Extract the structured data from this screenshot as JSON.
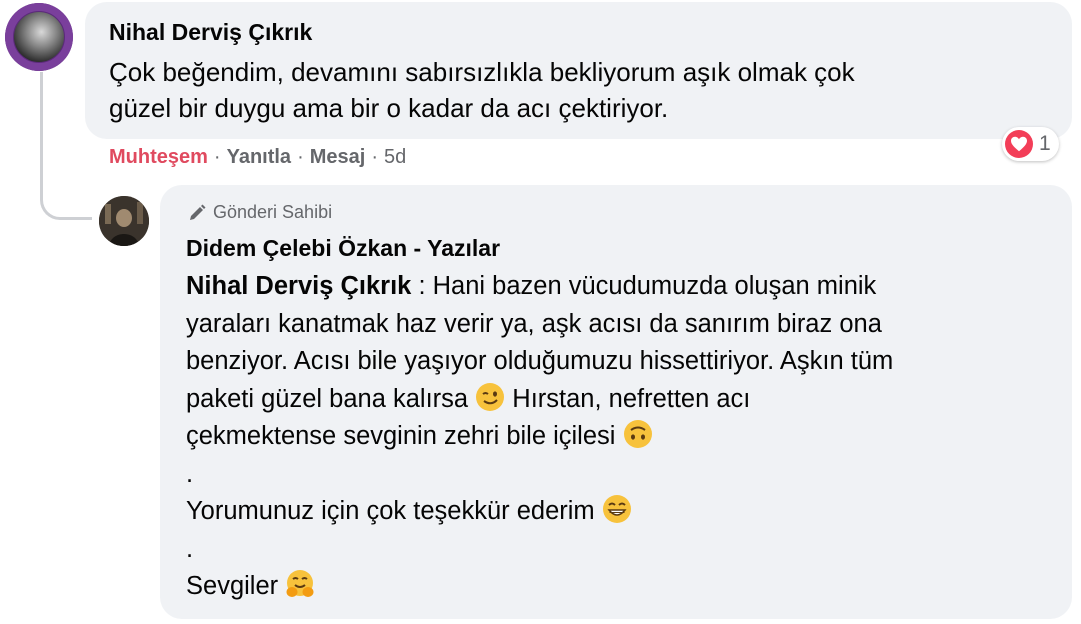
{
  "comment": {
    "author": "Nihal Derviş Çıkrık",
    "text_lines": [
      "Çok beğendim, devamını sabırsızlıkla bekliyorum aşık olmak çok",
      "güzel bir duygu ama bir o kadar da acı çektiriyor."
    ],
    "actions": {
      "reaction_label": "Muhteşem",
      "reply_label": "Yanıtla",
      "message_label": "Mesaj",
      "separator": "·",
      "time": "5d"
    },
    "reaction_count": "1",
    "reaction_icon": "heart-icon",
    "colors": {
      "reaction": "#e04a5f",
      "heart_badge": "#f33e58"
    }
  },
  "reply": {
    "badge_label": "Gönderi Sahibi",
    "badge_icon": "pencil-icon",
    "author": "Didem Çelebi Özkan - Yazılar",
    "mention": "Nihal Derviş Çıkrık",
    "lines": [
      " : Hani bazen vücudumuzda oluşan minik",
      "yaraları kanatmak haz verir ya, aşk acısı da sanırım biraz ona",
      "benziyor. Acısı bile yaşıyor olduğumuzu hissettiriyor. Aşkın tüm",
      "paketi güzel bana kalırsa",
      " Hırstan, nefretten acı",
      "çekmektense sevginin zehri bile içilesi",
      ".",
      "Yorumunuz için çok teşekkür ederim",
      ".",
      "Sevgiler"
    ],
    "emojis": [
      "winking-face-icon",
      "upside-down-face-icon",
      "grinning-face-icon",
      "hugging-face-icon"
    ]
  }
}
